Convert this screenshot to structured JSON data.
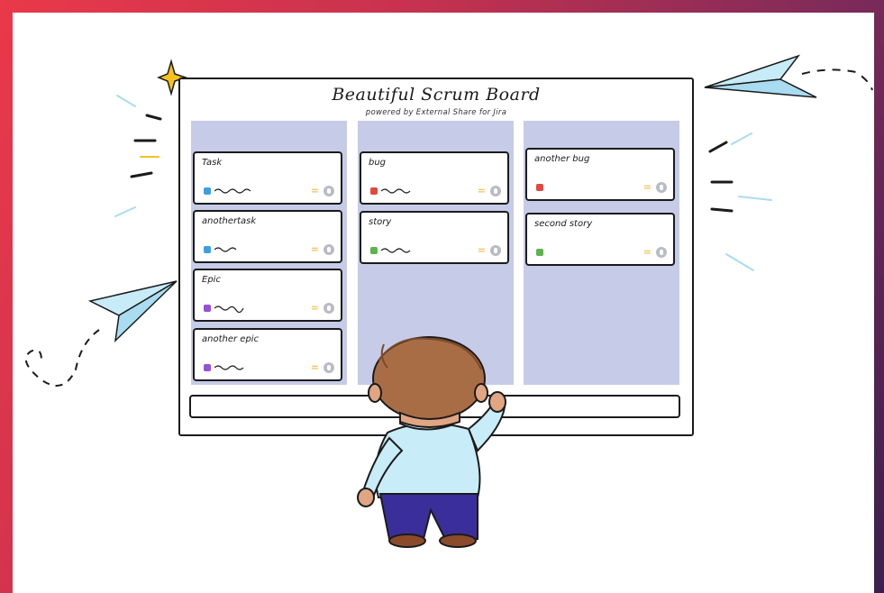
{
  "board": {
    "title": "Beautiful Scrum Board",
    "subtitle": "powered by External Share for Jira"
  },
  "columns": [
    {
      "cards": [
        {
          "title": "Task",
          "color": "#3aa0e6"
        },
        {
          "title": "anothertask",
          "color": "#3aa0e6"
        },
        {
          "title": "Epic",
          "color": "#9a4fd8"
        },
        {
          "title": "another epic",
          "color": "#9a4fd8"
        }
      ]
    },
    {
      "cards": [
        {
          "title": "bug",
          "color": "#e2493f"
        },
        {
          "title": "story",
          "color": "#5cb54a"
        }
      ]
    },
    {
      "cards": [
        {
          "title": "another bug",
          "color": "#e2493f"
        },
        {
          "title": "second story",
          "color": "#5cb54a"
        }
      ]
    }
  ],
  "icons": {
    "priority": "equals-priority-icon",
    "assignee": "avatar-icon",
    "sparkle": "sparkle-icon",
    "plane": "paper-plane-icon"
  }
}
